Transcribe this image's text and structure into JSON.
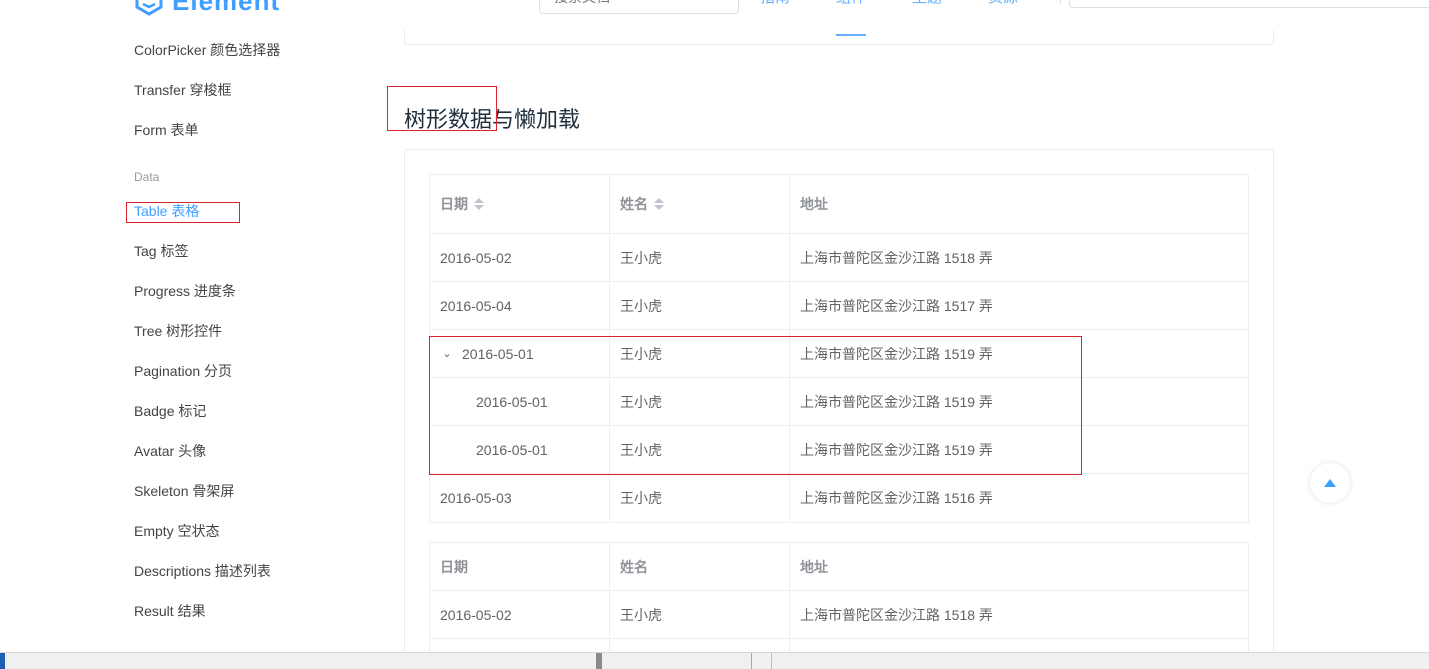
{
  "header": {
    "logo_text": "Element",
    "search_placeholder": "搜索文档",
    "nav": [
      {
        "label": "指南"
      },
      {
        "label": "组件"
      },
      {
        "label": "主题"
      },
      {
        "label": "资源"
      }
    ]
  },
  "sidebar": {
    "items_top": [
      {
        "label": "ColorPicker 颜色选择器"
      },
      {
        "label": "Transfer 穿梭框"
      },
      {
        "label": "Form 表单"
      }
    ],
    "group_label": "Data",
    "items_data": [
      {
        "label": "Table 表格"
      },
      {
        "label": "Tag 标签"
      },
      {
        "label": "Progress 进度条"
      },
      {
        "label": "Tree 树形控件"
      },
      {
        "label": "Pagination 分页"
      },
      {
        "label": "Badge 标记"
      },
      {
        "label": "Avatar 头像"
      },
      {
        "label": "Skeleton 骨架屏"
      },
      {
        "label": "Empty 空状态"
      },
      {
        "label": "Descriptions 描述列表"
      },
      {
        "label": "Result 结果"
      }
    ]
  },
  "main": {
    "section_title": "树形数据与懒加载",
    "table1": {
      "headers": [
        "日期",
        "姓名",
        "地址"
      ],
      "rows": [
        {
          "date": "2016-05-02",
          "name": "王小虎",
          "address": "上海市普陀区金沙江路 1518 弄"
        },
        {
          "date": "2016-05-04",
          "name": "王小虎",
          "address": "上海市普陀区金沙江路 1517 弄"
        },
        {
          "date": "2016-05-01",
          "name": "王小虎",
          "address": "上海市普陀区金沙江路 1519 弄"
        },
        {
          "date": "2016-05-01",
          "name": "王小虎",
          "address": "上海市普陀区金沙江路 1519 弄"
        },
        {
          "date": "2016-05-01",
          "name": "王小虎",
          "address": "上海市普陀区金沙江路 1519 弄"
        },
        {
          "date": "2016-05-03",
          "name": "王小虎",
          "address": "上海市普陀区金沙江路 1516 弄"
        }
      ]
    },
    "table2": {
      "headers": [
        "日期",
        "姓名",
        "地址"
      ],
      "rows": [
        {
          "date": "2016-05-02",
          "name": "王小虎",
          "address": "上海市普陀区金沙江路 1518 弄"
        }
      ]
    }
  },
  "colors": {
    "accent": "#409eff",
    "annotation_red": "#d9252e"
  }
}
